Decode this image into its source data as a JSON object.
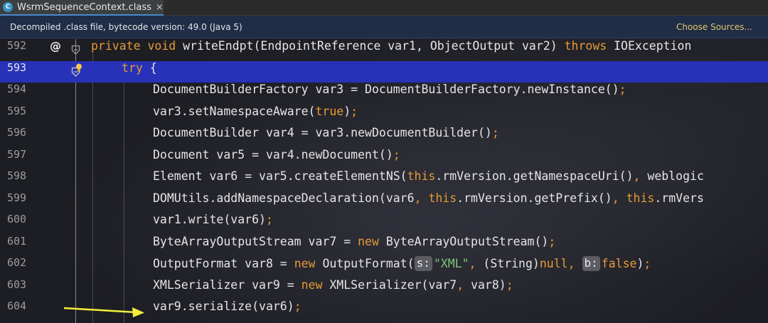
{
  "tab": {
    "icon_letter": "C",
    "title": "WsrmSequenceContext.class",
    "close": "×"
  },
  "banner": {
    "text": "Decompiled .class file, bytecode version: 49.0 (Java 5)",
    "link": "Choose Sources..."
  },
  "gutter": {
    "annotation_icon": "@"
  },
  "lines": [
    {
      "num": "592",
      "parts": [
        {
          "t": "private void ",
          "c": "kw"
        },
        {
          "t": "writeEndpt(EndpointReference var1, ObjectOutput var2) "
        },
        {
          "t": "throws ",
          "c": "kw"
        },
        {
          "t": "IOException"
        }
      ]
    },
    {
      "num": "593",
      "parts": [
        {
          "t": "try ",
          "c": "kw"
        },
        {
          "t": "{"
        }
      ]
    },
    {
      "num": "594",
      "parts": [
        {
          "t": "DocumentBuilderFactory var3 = DocumentBuilderFactory.newInstance()"
        },
        {
          "t": ";",
          "c": "kw"
        }
      ]
    },
    {
      "num": "595",
      "parts": [
        {
          "t": "var3.setNamespaceAware("
        },
        {
          "t": "true",
          "c": "kw"
        },
        {
          "t": ")"
        },
        {
          "t": ";",
          "c": "kw"
        }
      ]
    },
    {
      "num": "596",
      "parts": [
        {
          "t": "DocumentBuilder var4 = var3.newDocumentBuilder()"
        },
        {
          "t": ";",
          "c": "kw"
        }
      ]
    },
    {
      "num": "597",
      "parts": [
        {
          "t": "Document var5 = var4.newDocument()"
        },
        {
          "t": ";",
          "c": "kw"
        }
      ]
    },
    {
      "num": "598",
      "parts": [
        {
          "t": "Element var6 = var5.createElementNS("
        },
        {
          "t": "this",
          "c": "kw"
        },
        {
          "t": ".rmVersion.getNamespaceUri()"
        },
        {
          "t": ", ",
          "c": "kw"
        },
        {
          "t": "weblogic"
        }
      ]
    },
    {
      "num": "599",
      "parts": [
        {
          "t": "DOMUtils.addNamespaceDeclaration(var6"
        },
        {
          "t": ", ",
          "c": "kw"
        },
        {
          "t": "this",
          "c": "kw"
        },
        {
          "t": ".rmVersion.getPrefix()"
        },
        {
          "t": ", ",
          "c": "kw"
        },
        {
          "t": "this",
          "c": "kw"
        },
        {
          "t": ".rmVers"
        }
      ]
    },
    {
      "num": "600",
      "parts": [
        {
          "t": "var1.write(var6)"
        },
        {
          "t": ";",
          "c": "kw"
        }
      ]
    },
    {
      "num": "601",
      "parts": [
        {
          "t": "ByteArrayOutputStream var7 = "
        },
        {
          "t": "new ",
          "c": "kw"
        },
        {
          "t": "ByteArrayOutputStream()"
        },
        {
          "t": ";",
          "c": "kw"
        }
      ]
    },
    {
      "num": "602",
      "parts": [
        {
          "t": "OutputFormat var8 = "
        },
        {
          "t": "new ",
          "c": "kw"
        },
        {
          "t": "OutputFormat("
        },
        {
          "hint": "s:"
        },
        {
          "t": "\"XML\"",
          "c": "str"
        },
        {
          "t": ", ",
          "c": "kw"
        },
        {
          "t": "(String)"
        },
        {
          "t": "null",
          "c": "kw"
        },
        {
          "t": ", ",
          "c": "kw"
        },
        {
          "hint": "b:"
        },
        {
          "t": "false",
          "c": "kw"
        },
        {
          "t": ")"
        },
        {
          "t": ";",
          "c": "kw"
        }
      ]
    },
    {
      "num": "603",
      "parts": [
        {
          "t": "XMLSerializer var9 = "
        },
        {
          "t": "new ",
          "c": "kw"
        },
        {
          "t": "XMLSerializer(var7"
        },
        {
          "t": ", ",
          "c": "kw"
        },
        {
          "t": "var8)"
        },
        {
          "t": ";",
          "c": "kw"
        }
      ]
    },
    {
      "num": "604",
      "parts": [
        {
          "t": "var9.serialize(var6)"
        },
        {
          "t": ";",
          "c": "kw"
        }
      ]
    }
  ],
  "colors": {
    "keyword": "#e59b35",
    "string": "#7ec27a",
    "current_line": "#2732b8",
    "arrow": "#f3ef3a"
  }
}
